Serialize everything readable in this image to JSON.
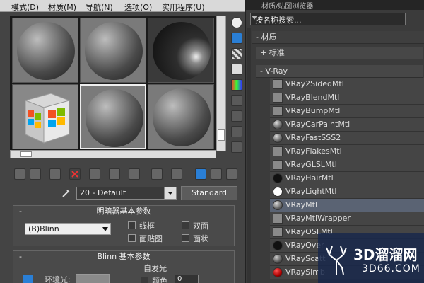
{
  "menu": {
    "items": [
      "模式(D)",
      "材质(M)",
      "导航(N)",
      "选项(O)",
      "实用程序(U)"
    ]
  },
  "slots": [
    {
      "kind": "sphere",
      "selected": false
    },
    {
      "kind": "sphere",
      "selected": false
    },
    {
      "kind": "sphere-dark",
      "selected": false
    },
    {
      "kind": "windows-cube",
      "selected": false
    },
    {
      "kind": "sphere",
      "selected": true
    },
    {
      "kind": "sphere",
      "selected": false
    }
  ],
  "material": {
    "name": "20 - Default",
    "type": "Standard"
  },
  "shader_rollout": {
    "title": "明暗器基本参数",
    "shader": "(B)Blinn",
    "wire": "线框",
    "two_sided": "双面",
    "face_map": "面贴图",
    "faceted": "面状"
  },
  "blinn_rollout": {
    "title": "Blinn 基本参数",
    "ambient": "环境光:",
    "self_illum": "自发光",
    "color": "颜色",
    "value": "0"
  },
  "browser": {
    "title": "材质/贴图浏览器",
    "search_placeholder": "按名称搜索...",
    "section_material": "- 材质",
    "group_standard": "+ 标准",
    "group_vray": "- V-Ray",
    "vray_items": [
      {
        "name": "VRay2SidedMtl",
        "icon": "square"
      },
      {
        "name": "VRayBlendMtl",
        "icon": "square"
      },
      {
        "name": "VRayBumpMtl",
        "icon": "square"
      },
      {
        "name": "VRayCarPaintMtl",
        "icon": "ball"
      },
      {
        "name": "VRayFastSSS2",
        "icon": "ball"
      },
      {
        "name": "VRayFlakesMtl",
        "icon": "square"
      },
      {
        "name": "VRayGLSLMtl",
        "icon": "square"
      },
      {
        "name": "VRayHairMtl",
        "icon": "black"
      },
      {
        "name": "VRayLightMtl",
        "icon": "white"
      },
      {
        "name": "VRayMtl",
        "icon": "ball"
      },
      {
        "name": "VRayMtlWrapper",
        "icon": "square"
      },
      {
        "name": "VRayOSLMtl",
        "icon": "square"
      },
      {
        "name": "VRayOver",
        "icon": "black"
      },
      {
        "name": "VRayScatt",
        "icon": "multi"
      },
      {
        "name": "VRaySimb",
        "icon": "red"
      }
    ],
    "selected_index": 9
  },
  "watermark": {
    "text": "3D溜溜网",
    "sub": "3D66.COM"
  },
  "colors": {
    "selection": "#5a6373",
    "accent": "#2a7fd6"
  }
}
